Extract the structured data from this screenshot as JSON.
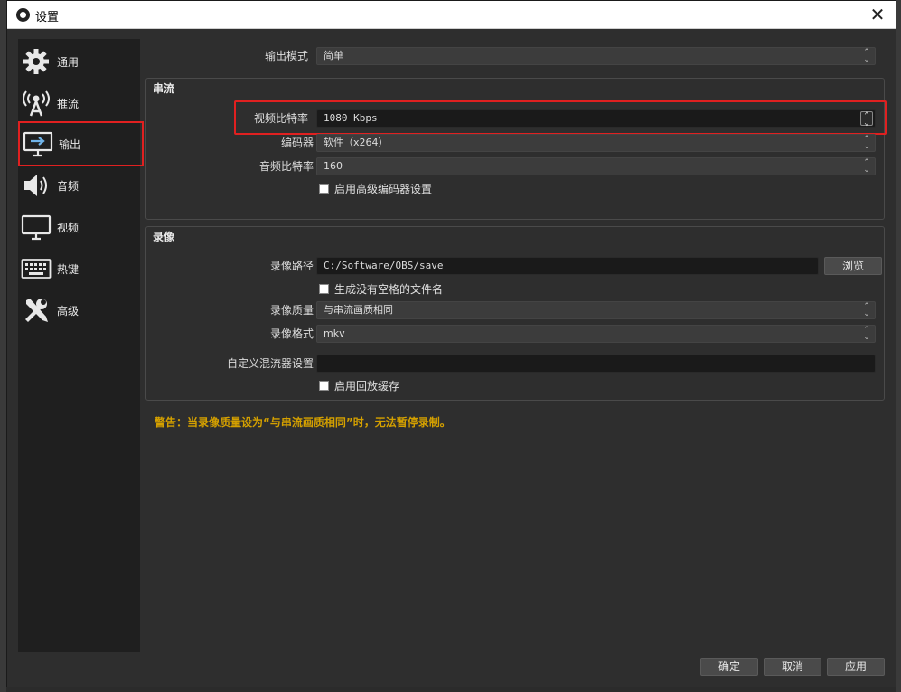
{
  "window": {
    "title": "设置",
    "close_glyph": "✕"
  },
  "sidebar": {
    "items": [
      {
        "label": "通用",
        "icon": "gear-icon"
      },
      {
        "label": "推流",
        "icon": "broadcast-tower-icon"
      },
      {
        "label": "输出",
        "icon": "output-monitor-icon",
        "selected": true
      },
      {
        "label": "音频",
        "icon": "speaker-icon"
      },
      {
        "label": "视频",
        "icon": "monitor-icon"
      },
      {
        "label": "热键",
        "icon": "keyboard-icon"
      },
      {
        "label": "高级",
        "icon": "tools-icon"
      }
    ]
  },
  "output_mode": {
    "label": "输出模式",
    "value": "简单"
  },
  "streaming": {
    "title": "串流",
    "video_bitrate": {
      "label": "视频比特率",
      "value": "1080 Kbps"
    },
    "encoder": {
      "label": "编码器",
      "value": "软件（x264）"
    },
    "audio_bitrate": {
      "label": "音频比特率",
      "value": "160"
    },
    "advanced_encoder": {
      "label": "启用高级编码器设置",
      "checked": false
    }
  },
  "recording": {
    "title": "录像",
    "path": {
      "label": "录像路径",
      "value": "C:/Software/OBS/save",
      "browse_label": "浏览"
    },
    "no_space_filename": {
      "label": "生成没有空格的文件名",
      "checked": false
    },
    "quality": {
      "label": "录像质量",
      "value": "与串流画质相同"
    },
    "format": {
      "label": "录像格式",
      "value": "mkv"
    },
    "muxer": {
      "label": "自定义混流器设置",
      "value": ""
    },
    "replay_buffer": {
      "label": "启用回放缓存",
      "checked": false
    }
  },
  "warning": "警告：当录像质量设为“与串流画质相同”时，无法暂停录制。",
  "footer": {
    "ok": "确定",
    "cancel": "取消",
    "apply": "应用"
  },
  "colors": {
    "highlight": "#e02020",
    "warning": "#d4a000",
    "sidebar_bg": "#1f1f1f",
    "panel_bg": "#2e2e2e"
  }
}
